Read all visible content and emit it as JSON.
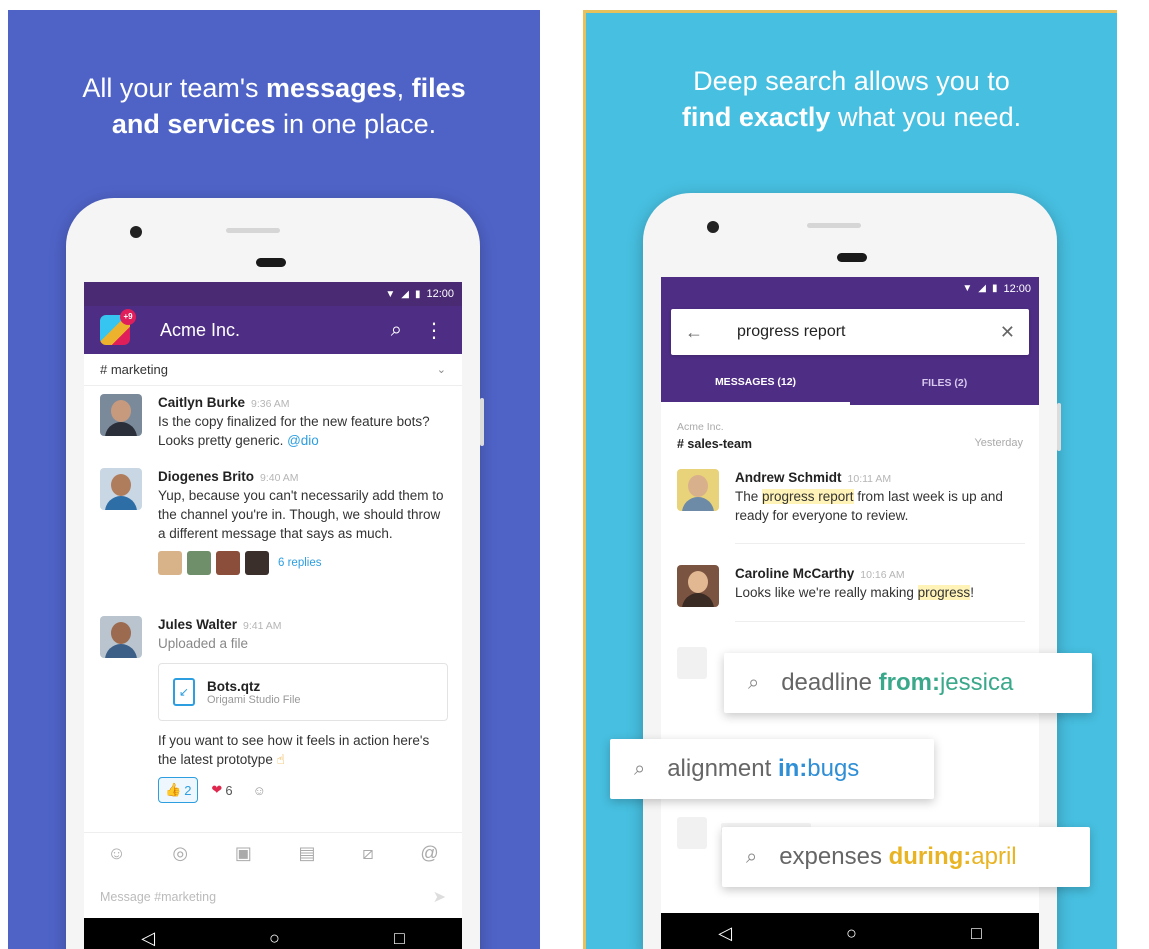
{
  "left_panel": {
    "headline_line1_pre": "All your team's ",
    "headline_line1_b1": "messages",
    "headline_line1_sep": ", ",
    "headline_line1_b2": "files",
    "headline_line2_b": "and services",
    "headline_line2_post": " in one place.",
    "status_time": "12:00",
    "team_badge": "+9",
    "team_name": "Acme Inc.",
    "channel": "# marketing",
    "messages": [
      {
        "author": "Caitlyn Burke",
        "time": "9:36 AM",
        "text": "Is the copy finalized for the new feature bots? Looks pretty generic. ",
        "mention": "@dio"
      },
      {
        "author": "Diogenes Brito",
        "time": "9:40 AM",
        "text": "Yup, because you can't necessarily add them to the channel you're in. Though, we should throw a different message that says as much.",
        "replies": "6 replies"
      },
      {
        "author": "Jules Walter",
        "time": "9:41 AM",
        "text": "Uploaded a file",
        "file_name": "Bots.qtz",
        "file_type": "Origami Studio File",
        "followup": "If you want to see how it feels in action here's the latest prototype",
        "followup_emoji": "☝",
        "reactions": [
          {
            "emoji": "👍",
            "count": "2"
          },
          {
            "emoji": "❤",
            "count": "6"
          },
          {
            "emoji": "☺",
            "count": ""
          }
        ]
      }
    ],
    "composer_placeholder": "Message #marketing"
  },
  "right_panel": {
    "headline_line1": "Deep search allows you to",
    "headline_line2_b": "find exactly",
    "headline_line2_post": " what you need.",
    "status_time": "12:00",
    "search_query": "progress report",
    "tabs": [
      {
        "label": "MESSAGES (12)"
      },
      {
        "label": "FILES (2)"
      }
    ],
    "result_team": "Acme Inc.",
    "result_channel": "# sales-team",
    "result_when": "Yesterday",
    "results": [
      {
        "author": "Andrew Schmidt",
        "time": "10:11 AM",
        "pre": "The ",
        "hl": "progress report",
        "post": " from last week is up and ready for everyone to review."
      },
      {
        "author": "Caroline McCarthy",
        "time": "10:16 AM",
        "pre": "Looks like we're really making ",
        "hl": "progress",
        "post": "!"
      }
    ],
    "chips": [
      {
        "term": "deadline ",
        "key": "from:",
        "value": "jessica"
      },
      {
        "term": "alignment ",
        "key": "in:",
        "value": "bugs"
      },
      {
        "term": "expenses ",
        "key": "during:",
        "value": "april"
      }
    ]
  },
  "colors": {
    "left_bg": "#4f63c7",
    "right_bg": "#47bfe0",
    "slack_purple": "#4e2d84",
    "link_blue": "#2d9ee0",
    "highlight": "#fff3b8"
  }
}
